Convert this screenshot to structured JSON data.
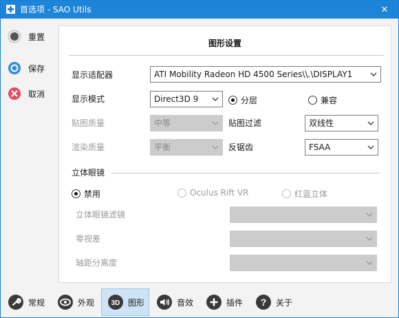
{
  "window": {
    "title": "首选项 - SAO Utils",
    "close_glyph": "✕",
    "accent": "#1e84d8"
  },
  "side_actions": [
    {
      "label": "重置",
      "icon": "reset-circle-icon"
    },
    {
      "label": "保存",
      "icon": "save-ring-icon"
    },
    {
      "label": "取消",
      "icon": "cancel-x-icon"
    }
  ],
  "panel": {
    "title": "图形设置",
    "adapter": {
      "label": "显示适配器",
      "value": "ATI Mobility Radeon HD 4500 Series\\\\.\\DISPLAY1"
    },
    "display_mode": {
      "label": "显示模式",
      "value": "Direct3D 9",
      "radio_layered": "分层",
      "radio_compat": "兼容"
    },
    "texture_quality": {
      "label": "贴图质量",
      "value": "中等"
    },
    "texture_filter": {
      "label": "贴图过滤",
      "value": "双线性"
    },
    "render_quality": {
      "label": "渲染质量",
      "value": "平衡"
    },
    "anti_alias": {
      "label": "反锯齿",
      "value": "FSAA"
    },
    "stereo": {
      "group_label": "立体眼镜",
      "option_disable": "禁用",
      "option_oculus": "Oculus Rift VR",
      "option_anaglyph": "红蓝立体",
      "filter_label": "立体眼镜滤镜",
      "zero_parallax_label": "零视差",
      "axis_distance_label": "轴距分离度"
    }
  },
  "tabs": [
    {
      "label": "常规",
      "icon": "wrench-icon"
    },
    {
      "label": "外观",
      "icon": "eye-icon"
    },
    {
      "label": "图形",
      "icon": "3d-icon",
      "icon_text": "3D",
      "active": true
    },
    {
      "label": "音效",
      "icon": "speaker-icon"
    },
    {
      "label": "插件",
      "icon": "plus-icon"
    },
    {
      "label": "关于",
      "icon": "question-icon",
      "icon_text": "?"
    }
  ]
}
